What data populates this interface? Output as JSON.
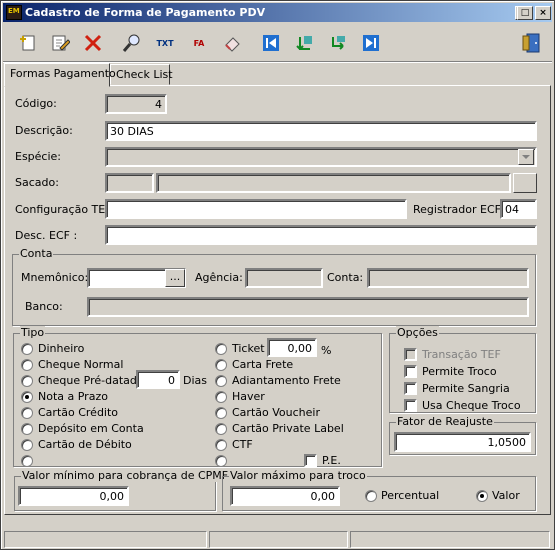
{
  "window": {
    "title": "Cadastro de Forma de Pagamento PDV"
  },
  "title_buttons": {
    "minimize": "_",
    "maximize": "□",
    "close": "×"
  },
  "icons": {
    "toolbar": [
      "new-icon",
      "edit-icon",
      "delete-icon",
      "search-icon",
      "txt-icon",
      "fa-icon",
      "eraser-icon",
      "first-icon",
      "prev-icon",
      "next-icon",
      "last-icon",
      "exit-door-icon"
    ],
    "txt_label": "TXT",
    "fa_label": "FA"
  },
  "tabs": [
    {
      "label": "Formas Pagamento"
    },
    {
      "label": "Check List"
    }
  ],
  "form": {
    "codigo_label": "Código:",
    "codigo_value": "4",
    "descricao_label": "Descrição:",
    "descricao_value": "30 DIAS",
    "especie_label": "Espécie:",
    "sacado_label": "Sacado:",
    "config_tef_label": "Configuração TEF:",
    "registrador_label": "Registrador ECF:",
    "registrador_value": "04",
    "desc_ecf_label": "Desc. ECF :"
  },
  "conta": {
    "caption": "Conta",
    "mnemonico_label": "Mnemônico:",
    "ellipsis": "...",
    "agencia_label": "Agência:",
    "conta_label": "Conta:",
    "banco_label": "Banco:"
  },
  "tipo": {
    "caption": "Tipo",
    "left": [
      "Dinheiro",
      "Cheque Normal",
      "Cheque Pré-datado",
      "Nota a Prazo",
      "Cartão Crédito",
      "Depósito em Conta",
      "Cartão de Débito",
      ""
    ],
    "selected": "Nota a Prazo",
    "dias_value": "0",
    "dias_label": "Dias",
    "ticket_label": "Ticket",
    "ticket_value": "0,00",
    "percent": "%",
    "right": [
      "Carta Frete",
      "Adiantamento Frete",
      "Haver",
      "Cartão Voucheir",
      "Cartão Private Label",
      "CTF",
      ""
    ],
    "pe_label": "P.E."
  },
  "opcoes": {
    "caption": "Opções",
    "items": [
      {
        "label": "Transação TEF",
        "enabled": false
      },
      {
        "label": "Permite Troco",
        "enabled": true
      },
      {
        "label": "Permite Sangria",
        "enabled": true
      },
      {
        "label": "Usa Cheque Troco",
        "enabled": true
      }
    ]
  },
  "fator": {
    "caption": "Fator de Reajuste",
    "value": "1,0500"
  },
  "cpmf": {
    "caption": "Valor mínimo para cobrança de CPMF",
    "value": "0,00"
  },
  "troco": {
    "caption": "Valor máximo para troco",
    "value": "0,00",
    "percentual_label": "Percentual",
    "valor_label": "Valor",
    "selected": "Valor"
  }
}
